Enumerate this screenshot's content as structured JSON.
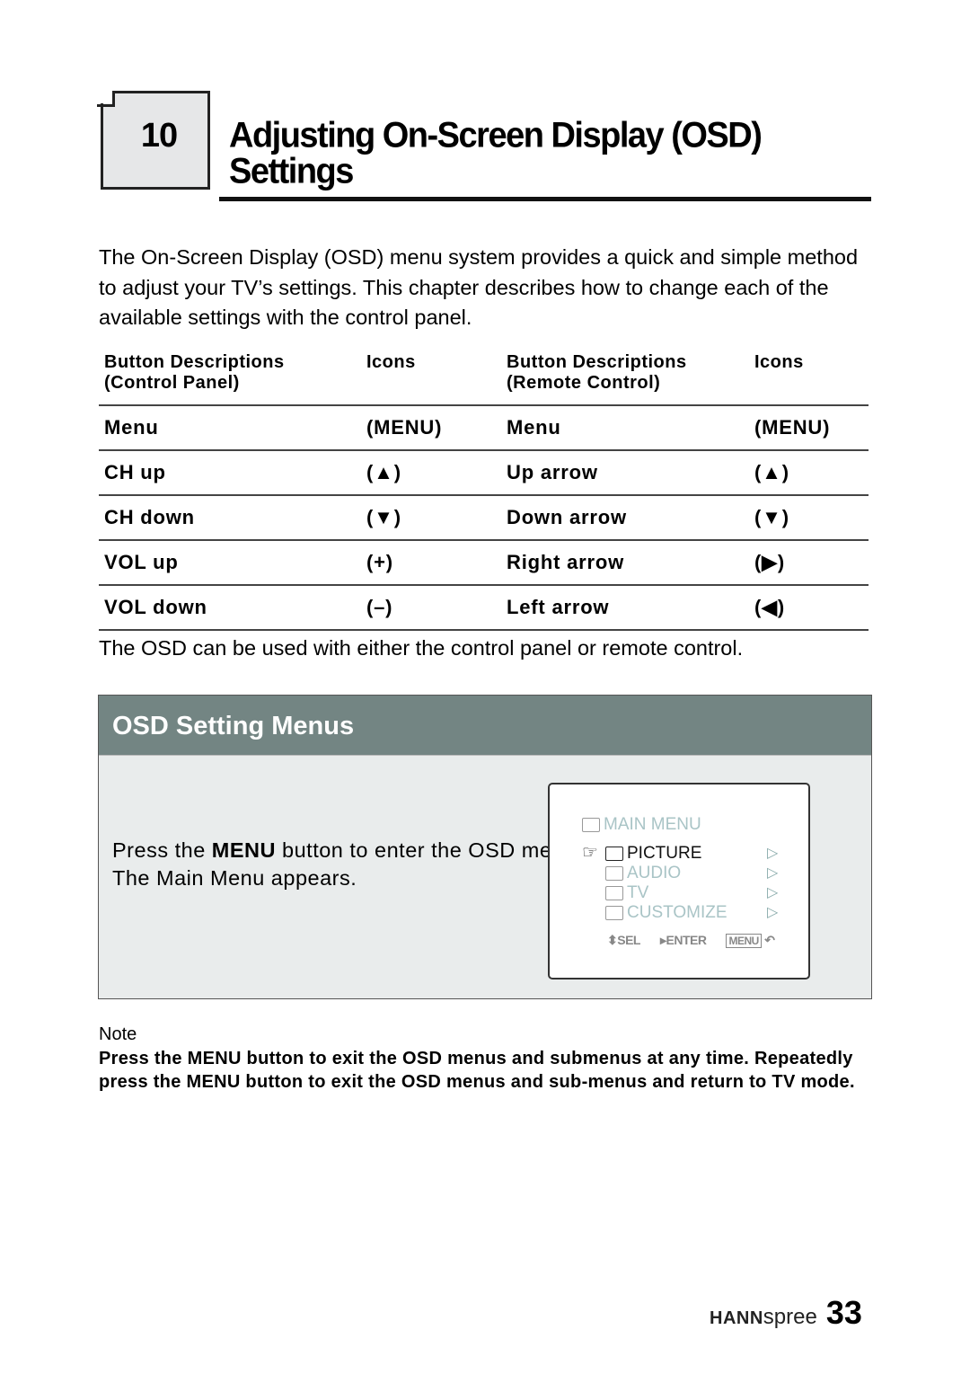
{
  "chapter": {
    "number": "10",
    "title_line1": "Adjusting On-Screen Display (OSD)",
    "title_line2": "Settings"
  },
  "intro": "The On-Screen Display (OSD) menu system provides a quick and simple method to adjust your TV’s settings. This chapter describes how to change each of the available settings with the control panel.",
  "table": {
    "headers": {
      "cp_desc_1": "Button Descriptions",
      "cp_desc_2": "(Control Panel)",
      "icons_1": "Icons",
      "rc_desc_1": "Button Descriptions",
      "rc_desc_2": "(Remote Control)",
      "icons_2": "Icons"
    },
    "rows": [
      {
        "cp": "Menu",
        "cp_icon": "(MENU)",
        "rc": "Menu",
        "rc_icon": "(MENU)"
      },
      {
        "cp": "CH up",
        "cp_icon": "(▲)",
        "rc": "Up arrow",
        "rc_icon": "(▲)"
      },
      {
        "cp": "CH down",
        "cp_icon": "(▼)",
        "rc": "Down arrow",
        "rc_icon": "(▼)"
      },
      {
        "cp": "VOL up",
        "cp_icon": "(+)",
        "rc": "Right arrow",
        "rc_icon": "(▶)"
      },
      {
        "cp": "VOL down",
        "cp_icon": "(–)",
        "rc": "Left arrow",
        "rc_icon": "(◀)"
      }
    ]
  },
  "osd_note": "The OSD can be used with either the control panel or remote control.",
  "panel": {
    "title": "OSD Setting Menus",
    "text_pre": "Press the ",
    "text_bold": "MENU",
    "text_post": " button to enter the OSD menus.",
    "text_line3": "The Main Menu appears.",
    "screen": {
      "title": "MAIN  MENU",
      "items": [
        {
          "label": "PICTURE",
          "icon": "picture-icon",
          "active": true
        },
        {
          "label": "AUDIO",
          "icon": "audio-icon",
          "active": false
        },
        {
          "label": "TV",
          "icon": "tv-icon",
          "active": false
        },
        {
          "label": "CUSTOMIZE",
          "icon": "customize-icon",
          "active": false
        }
      ],
      "footer": {
        "sel": "SEL",
        "enter": "ENTER",
        "menu": "MENU"
      }
    }
  },
  "note": {
    "title": "Note",
    "body": "Press the MENU button to exit the OSD menus and submenus at any time. Repeatedly press the MENU button to exit the OSD menus and sub-menus and return to TV mode."
  },
  "footer": {
    "brand_bold": "HANN",
    "brand_light": "spree",
    "page": "33"
  }
}
